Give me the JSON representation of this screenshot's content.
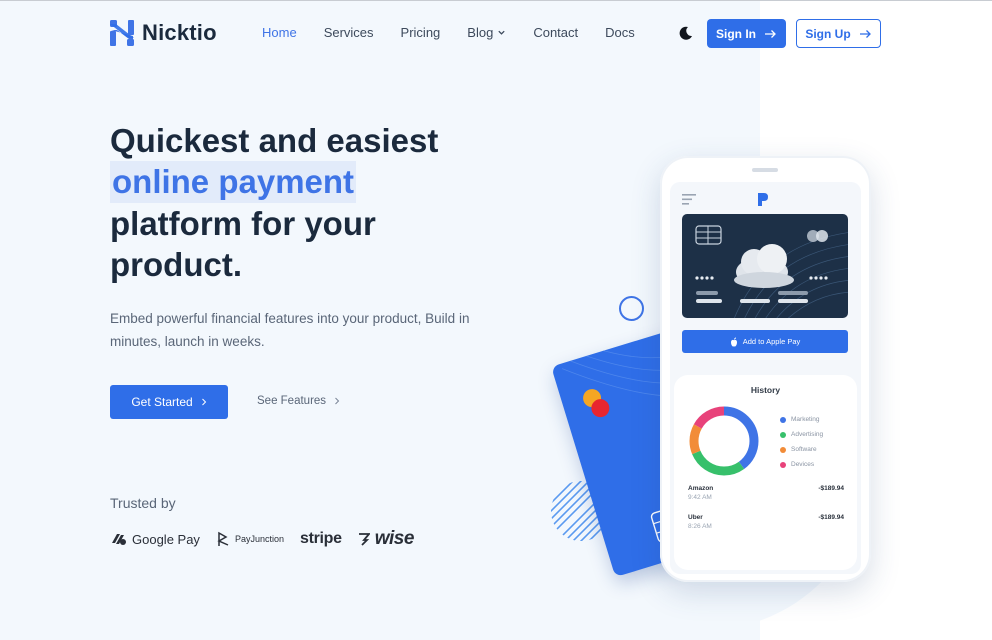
{
  "brand": {
    "name": "Nicktio"
  },
  "nav": {
    "items": [
      {
        "label": "Home",
        "active": true
      },
      {
        "label": "Services"
      },
      {
        "label": "Pricing"
      },
      {
        "label": "Blog",
        "dropdown": true
      },
      {
        "label": "Contact"
      },
      {
        "label": "Docs"
      }
    ],
    "theme_toggle_icon": "moon-icon",
    "sign_in": "Sign In",
    "sign_up": "Sign Up"
  },
  "hero": {
    "headline_line1": "Quickest and easiest",
    "headline_highlight": "online payment",
    "headline_line3": "platform for your",
    "headline_line4": "product.",
    "subtext": "Embed powerful financial features into your product, Build in minutes, launch in weeks.",
    "primary_cta": "Get Started",
    "secondary_cta": "See Features"
  },
  "trusted": {
    "label": "Trusted by",
    "brands": [
      "Google Pay",
      "PayJunction",
      "stripe",
      "wise"
    ]
  },
  "phone": {
    "apple_pay_label": "Add to Apple Pay",
    "history": {
      "title": "History",
      "legend": [
        {
          "label": "Marketing",
          "color": "#3f74e6"
        },
        {
          "label": "Advertising",
          "color": "#37c06b"
        },
        {
          "label": "Software",
          "color": "#f28c38"
        },
        {
          "label": "Devices",
          "color": "#e8427a"
        }
      ],
      "transactions": [
        {
          "name": "Amazon",
          "time": "9:42 AM",
          "amount": "-$189.94"
        },
        {
          "name": "Uber",
          "time": "8:26 AM",
          "amount": "-$189.94"
        }
      ]
    }
  },
  "colors": {
    "accent": "#2f6ee8",
    "heading": "#1b2a3d",
    "hero_bg": "#f3f8fd"
  }
}
